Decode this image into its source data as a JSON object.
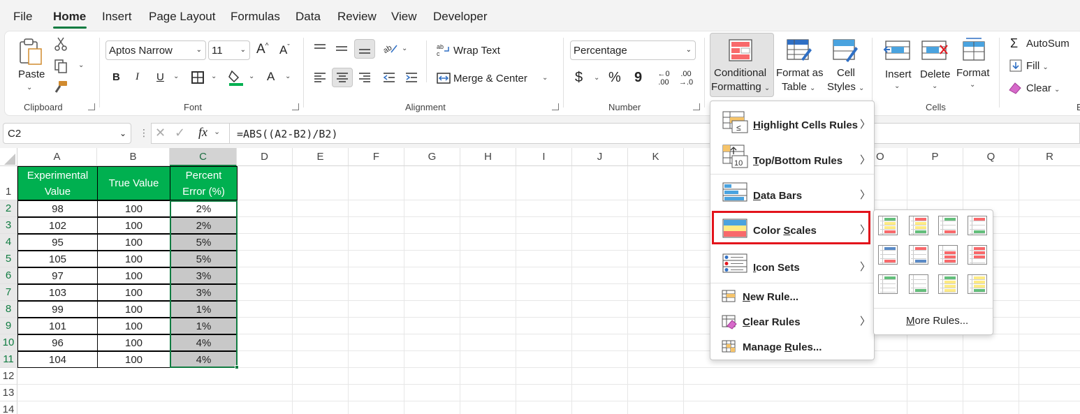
{
  "menu": {
    "tabs": [
      "File",
      "Home",
      "Insert",
      "Page Layout",
      "Formulas",
      "Data",
      "Review",
      "View",
      "Developer"
    ],
    "active": "Home"
  },
  "ribbon": {
    "clipboard": {
      "paste_label": "Paste",
      "group_label": "Clipboard"
    },
    "font": {
      "font_name": "Aptos Narrow",
      "font_size": "11",
      "bold": "B",
      "italic": "I",
      "underline": "U",
      "group_label": "Font",
      "grow": "A",
      "shrink": "A",
      "font_color": "A"
    },
    "alignment": {
      "wrap_text": "Wrap Text",
      "merge_center": "Merge & Center",
      "group_label": "Alignment"
    },
    "number": {
      "format": "Percentage",
      "currency": "$",
      "percent": "%",
      "comma": "9",
      "inc_decimal_top": "←0",
      "inc_decimal_bottom": ".00",
      "dec_decimal_top": ".00",
      "dec_decimal_bottom": "→.0",
      "group_label": "Number"
    },
    "styles": {
      "conditional_formatting_1": "Conditional",
      "conditional_formatting_2": "Formatting",
      "format_as_table_1": "Format as",
      "format_as_table_2": "Table",
      "cell_styles_1": "Cell",
      "cell_styles_2": "Styles"
    },
    "cells": {
      "insert": "Insert",
      "delete": "Delete",
      "format": "Format",
      "group_label": "Cells"
    },
    "editing": {
      "autosum": "AutoSum",
      "fill": "Fill",
      "clear": "Clear",
      "truncated_label": "E"
    }
  },
  "formula_bar": {
    "name_box": "C2",
    "fx": "fx",
    "formula": "=ABS((A2-B2)/B2)"
  },
  "grid": {
    "columns": [
      "A",
      "B",
      "C",
      "D",
      "E",
      "F",
      "G",
      "H",
      "I",
      "J",
      "K",
      "O",
      "P",
      "Q",
      "R"
    ],
    "rows": [
      "1",
      "2",
      "3",
      "4",
      "5",
      "6",
      "7",
      "8",
      "9",
      "10",
      "11",
      "12",
      "13",
      "14"
    ],
    "headers": {
      "a1_line1": "Experimental",
      "a1_line2": "Value",
      "b1": "True Value",
      "c1_line1": "Percent",
      "c1_line2": "Error (%)"
    },
    "data": [
      [
        "98",
        "100",
        "2%"
      ],
      [
        "102",
        "100",
        "2%"
      ],
      [
        "95",
        "100",
        "5%"
      ],
      [
        "105",
        "100",
        "5%"
      ],
      [
        "97",
        "100",
        "3%"
      ],
      [
        "103",
        "100",
        "3%"
      ],
      [
        "99",
        "100",
        "1%"
      ],
      [
        "101",
        "100",
        "1%"
      ],
      [
        "96",
        "100",
        "4%"
      ],
      [
        "104",
        "100",
        "4%"
      ]
    ]
  },
  "cf_menu": {
    "items": [
      {
        "label": "Highlight Cells Rules",
        "underline_char": "H",
        "rest": "ighlight Cells Rules"
      },
      {
        "label": "Top/Bottom Rules",
        "underline_char": "T",
        "rest": "op/Bottom Rules"
      },
      {
        "label": "Data Bars",
        "underline_char": "D",
        "rest": "ata Bars"
      },
      {
        "label": "Color Scales",
        "pre": "Color ",
        "underline_char": "S",
        "rest": "cales"
      },
      {
        "label": "Icon Sets",
        "underline_char": "I",
        "rest": "con Sets"
      }
    ],
    "new_rule": {
      "underline_char": "N",
      "rest": "ew Rule..."
    },
    "clear_rules": {
      "underline_char": "C",
      "rest": "lear Rules"
    },
    "manage_rules": {
      "pre": "Manage ",
      "underline_char": "R",
      "rest": "ules..."
    },
    "icon_top_bottom_number": "10"
  },
  "color_scales_submenu": {
    "more_rules": {
      "underline_char": "M",
      "rest": "ore Rules..."
    },
    "scales": [
      [
        "#63be7b",
        "#ffeb84",
        "#f8696b"
      ],
      [
        "#f8696b",
        "#ffeb84",
        "#63be7b"
      ],
      [
        "#63be7b",
        "#ffffff",
        "#f8696b"
      ],
      [
        "#f8696b",
        "#ffffff",
        "#63be7b"
      ],
      [
        "#5a8ac6",
        "#ffffff",
        "#f8696b"
      ],
      [
        "#f8696b",
        "#ffffff",
        "#5a8ac6"
      ],
      [
        "#ffffff",
        "#f8696b",
        "#f8696b"
      ],
      [
        "#f8696b",
        "#f8696b",
        "#ffffff"
      ],
      [
        "#63be7b",
        "#ffffff",
        "#ffffff"
      ],
      [
        "#ffffff",
        "#ffffff",
        "#63be7b"
      ],
      [
        "#63be7b",
        "#ffeb84",
        "#ffeb84"
      ],
      [
        "#ffeb84",
        "#ffeb84",
        "#63be7b"
      ]
    ]
  },
  "colors": {
    "accent": "#107c41",
    "header_fill": "#00b050",
    "highlight": "#e3141c"
  }
}
